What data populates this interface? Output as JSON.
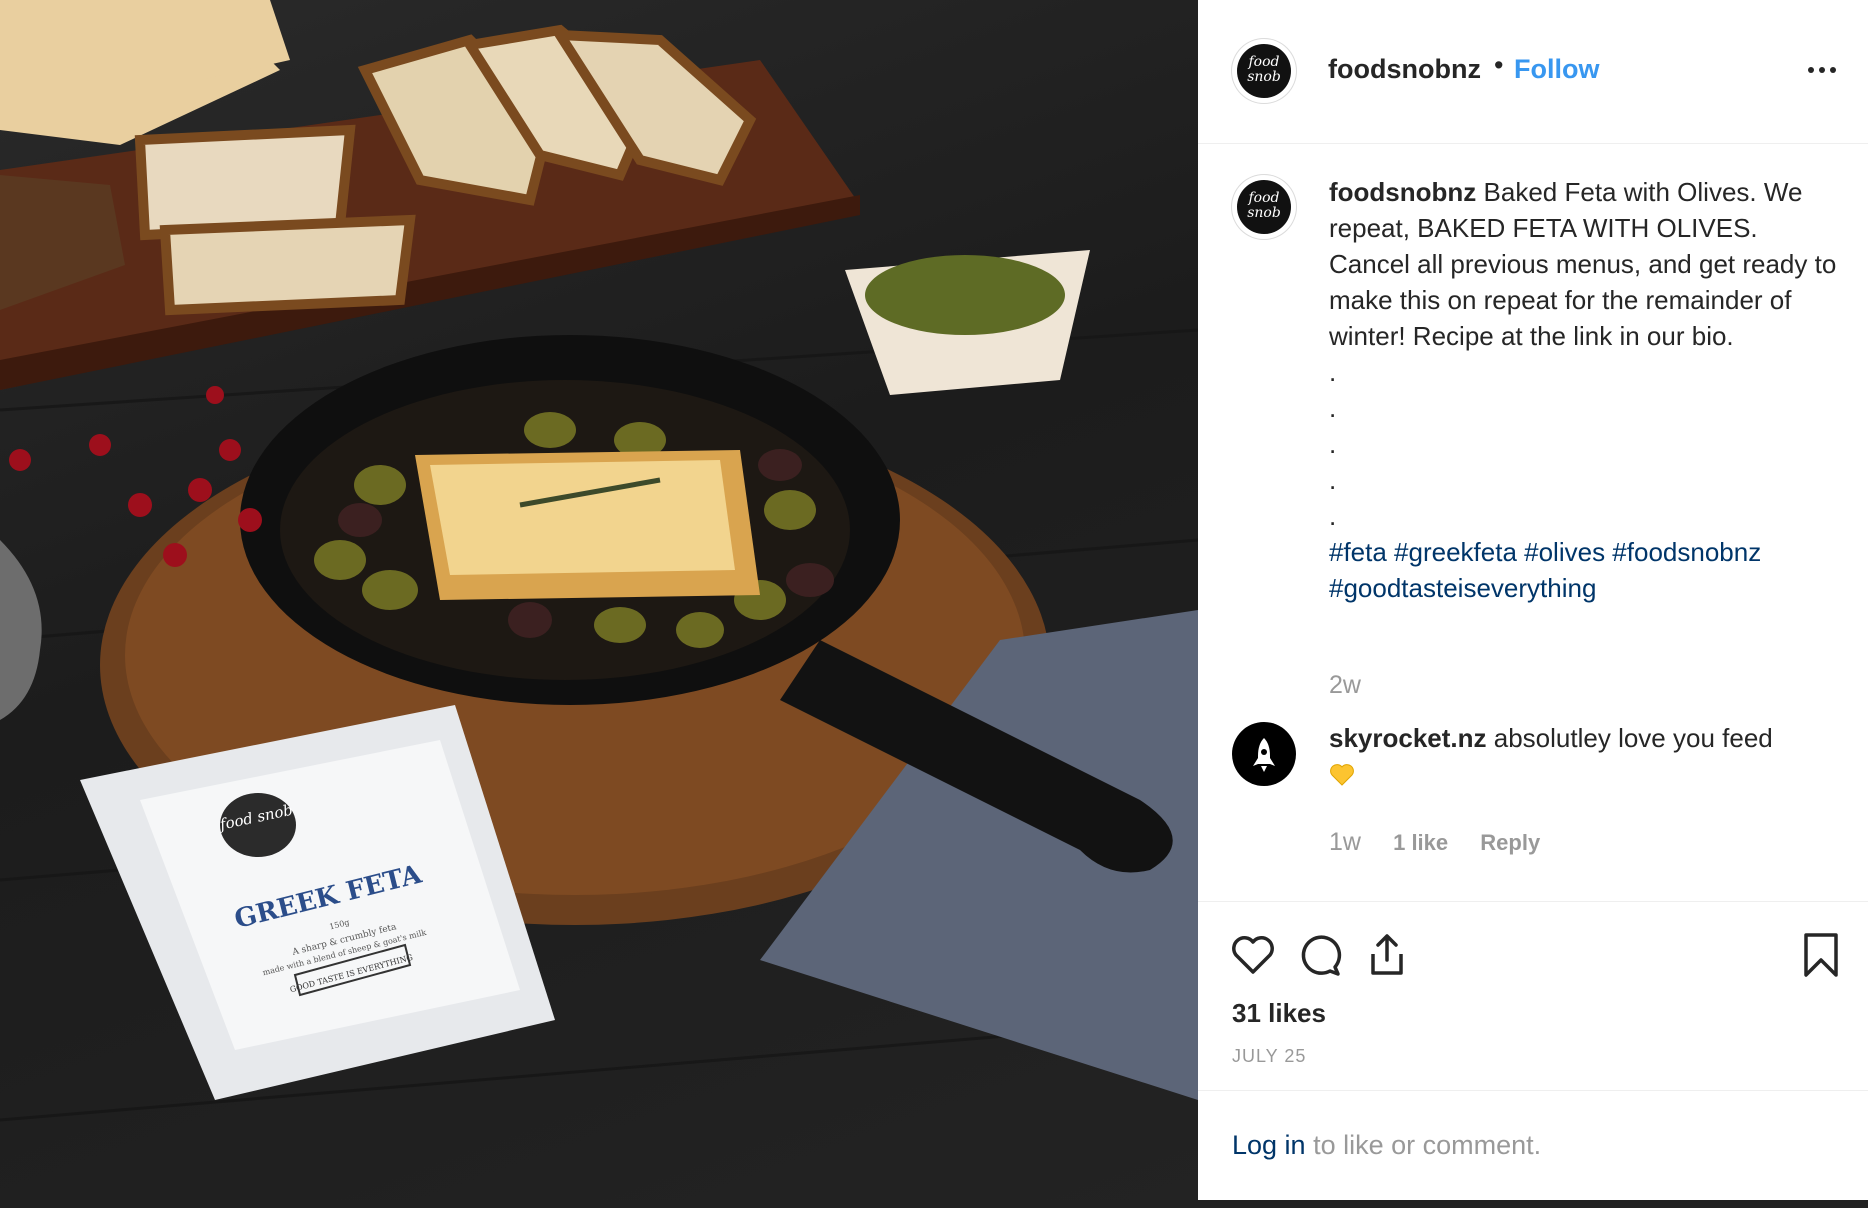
{
  "post": {
    "author": "foodsnobnz",
    "author_avatar_text": "food snob",
    "separator": "•",
    "follow_label": "Follow",
    "more_icon": "more-options-icon"
  },
  "caption": {
    "username": "foodsnobnz",
    "text": "Baked Feta with Olives. We repeat, BAKED FETA WITH OLIVES. Cancel all previous menus, and get ready to make this on repeat for the remainder of winter! Recipe at the link in our bio.",
    "dots": [
      ".",
      ".",
      ".",
      ".",
      "."
    ],
    "hashtags": "#feta #greekfeta #olives #foodsnobnz #goodtasteiseverything",
    "age": "2w"
  },
  "comment": {
    "username": "skyrocket.nz",
    "text": "absolutley love you feed",
    "emoji": "yellow-heart-icon",
    "age": "1w",
    "likes": "1 like",
    "reply_label": "Reply"
  },
  "actions": {
    "like_icon": "heart-icon",
    "comment_icon": "comment-icon",
    "share_icon": "share-icon",
    "save_icon": "bookmark-icon",
    "likes_count": "31 likes",
    "date": "JULY 25"
  },
  "footer": {
    "login_link": "Log in",
    "login_rest": " to like or comment."
  },
  "photo": {
    "package_brand": "food snob",
    "package_title": "GREEK FETA",
    "package_weight": "150g",
    "package_desc_1": "A sharp & crumbly feta",
    "package_desc_2": "made with a blend of sheep & goat's milk",
    "package_banner": "GOOD TASTE IS EVERYTHING"
  },
  "colors": {
    "accent": "#3897f0",
    "hashtag": "#003569",
    "muted": "#999999"
  }
}
